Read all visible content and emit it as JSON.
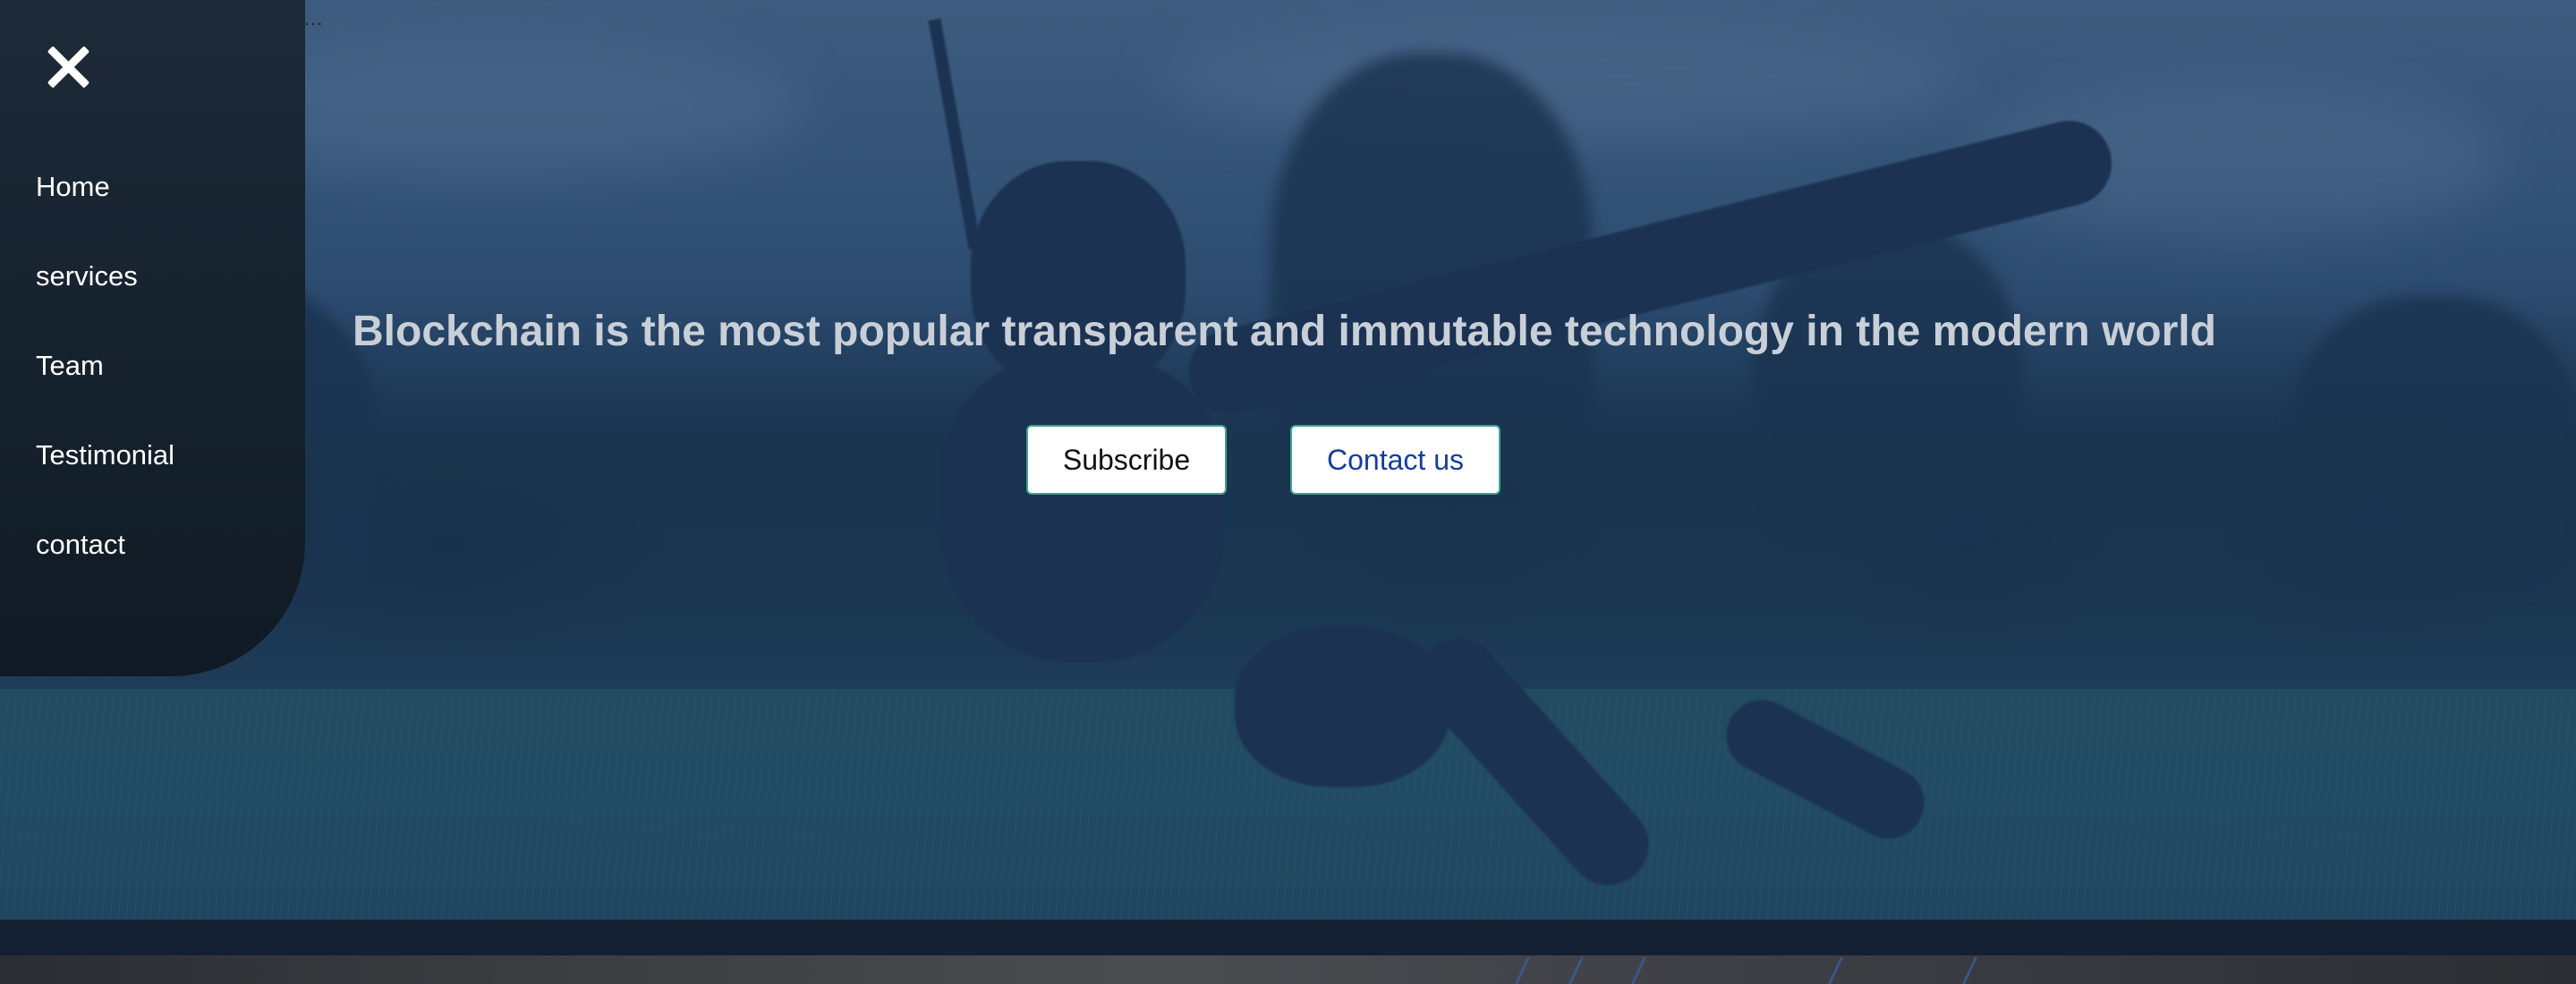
{
  "sidebar": {
    "close_icon": "close-icon",
    "items": [
      {
        "label": "Home"
      },
      {
        "label": "services"
      },
      {
        "label": "Team"
      },
      {
        "label": "Testimonial"
      },
      {
        "label": "contact"
      }
    ]
  },
  "hero": {
    "headline": "Blockchain is the most popular transparent and immutable technology in the modern world",
    "buttons": {
      "subscribe": "Subscribe",
      "contact": "Contact us"
    },
    "top_dots": "..."
  },
  "colors": {
    "sidebar_bg": "#16222e",
    "hero_overlay": "#1f3f65",
    "headline": "#c9cfd7",
    "button_border": "#3ca58e",
    "contact_text": "#163d9a",
    "bottom_band": "#132031"
  }
}
